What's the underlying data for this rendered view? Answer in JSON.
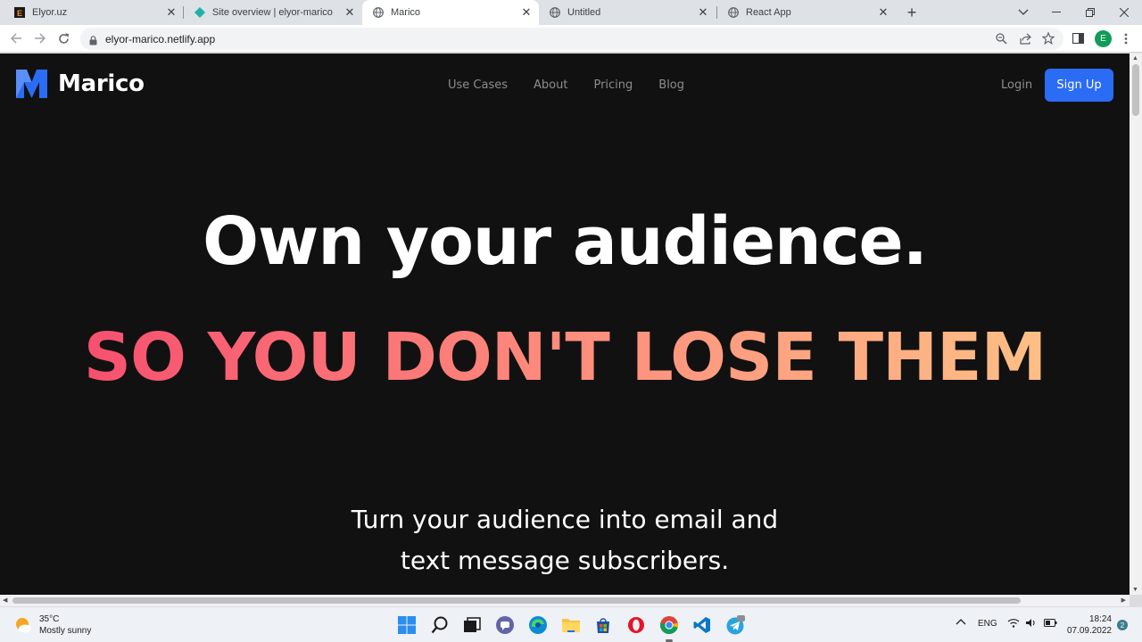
{
  "browser": {
    "tabs": [
      {
        "title": "Elyor.uz",
        "icon": "elyor-e-icon"
      },
      {
        "title": "Site overview | elyor-marico",
        "icon": "netlify-diamond-icon"
      },
      {
        "title": "Marico",
        "icon": "globe-icon",
        "active": true
      },
      {
        "title": "Untitled",
        "icon": "globe-icon"
      },
      {
        "title": "React App",
        "icon": "globe-icon"
      }
    ],
    "new_tab": "+",
    "url": "elyor-marico.netlify.app",
    "profile_initial": "E"
  },
  "page": {
    "brand": "Marico",
    "brand_color": "#2b6cf5",
    "nav": [
      "Use Cases",
      "About",
      "Pricing",
      "Blog"
    ],
    "login": "Login",
    "signup": "Sign Up",
    "headline": "Own your audience.",
    "subheadline": "SO YOU DON'T LOSE THEM",
    "gradient": [
      "#f6506f",
      "#fd8a7c",
      "#fdbf86"
    ],
    "description_line1": "Turn your audience into email and",
    "description_line2": "text message subscribers."
  },
  "taskbar": {
    "weather_temp": "35°C",
    "weather_desc": "Mostly sunny",
    "language": "ENG",
    "time": "18:24",
    "date": "07.09.2022",
    "notifications": "2"
  }
}
